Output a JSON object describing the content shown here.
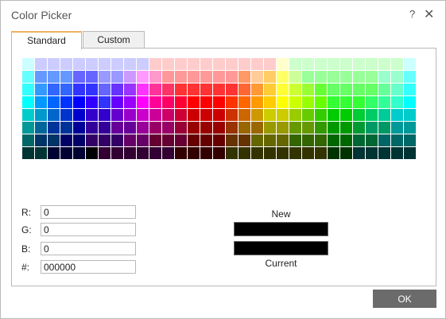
{
  "dialog": {
    "title": "Color Picker",
    "help_glyph": "?",
    "close_glyph": "✕"
  },
  "tabs": [
    {
      "label": "Standard",
      "active": true
    },
    {
      "label": "Custom",
      "active": false
    }
  ],
  "palette": {
    "columns": 31,
    "rows": 9,
    "colors": [
      [
        "#ccffff",
        "#ccccff",
        "#ccccff",
        "#ccccff",
        "#ccccff",
        "#ccccff",
        "#ccccff",
        "#ccccff",
        "#ccccff",
        "#ccccff",
        "#ffcccc",
        "#ffcccc",
        "#ffcccc",
        "#ffcccc",
        "#ffcccc",
        "#ffcccc",
        "#ffcccc",
        "#ffcccc",
        "#ffcccc",
        "#ffcccc",
        "#ffffcc",
        "#ccffcc",
        "#ccffcc",
        "#ccffcc",
        "#ccffcc",
        "#ccffcc",
        "#ccffcc",
        "#ccffcc",
        "#ccffcc",
        "#ccffcc",
        "#ccffff"
      ],
      [
        "#66ffff",
        "#6699ff",
        "#6699ff",
        "#6699ff",
        "#6666ff",
        "#6666ff",
        "#9999ff",
        "#9999ff",
        "#cc99ff",
        "#ff99ff",
        "#ff99cc",
        "#ff9999",
        "#ff9999",
        "#ff9999",
        "#ff9999",
        "#ff9999",
        "#ff9999",
        "#ff9966",
        "#ffcc99",
        "#ffcc66",
        "#ffff66",
        "#ccff99",
        "#99ff99",
        "#99ff99",
        "#99ff99",
        "#99ff99",
        "#99ff99",
        "#99ff99",
        "#99ffcc",
        "#99ffcc",
        "#66ffff"
      ],
      [
        "#33ffff",
        "#3399ff",
        "#3366ff",
        "#3366ff",
        "#3333ff",
        "#3333ff",
        "#6666ff",
        "#6633ff",
        "#9933ff",
        "#ff33ff",
        "#ff3399",
        "#ff3366",
        "#ff3333",
        "#ff3333",
        "#ff3333",
        "#ff3333",
        "#ff3333",
        "#ff6633",
        "#ff9933",
        "#ffcc33",
        "#ffff33",
        "#ccff33",
        "#99ff33",
        "#66ff33",
        "#66ff66",
        "#66ff66",
        "#66ff66",
        "#66ff66",
        "#66ff99",
        "#66ffcc",
        "#33ffff"
      ],
      [
        "#00ffff",
        "#0099ff",
        "#0066ff",
        "#0033ff",
        "#0000ff",
        "#3300ff",
        "#3333ff",
        "#6600ff",
        "#9900ff",
        "#ff00ff",
        "#ff0099",
        "#ff0066",
        "#ff0033",
        "#ff0000",
        "#ff0000",
        "#ff0000",
        "#ff3300",
        "#ff6600",
        "#ff9900",
        "#ffcc00",
        "#ffff00",
        "#ccff00",
        "#99ff00",
        "#66ff00",
        "#33ff33",
        "#33ff33",
        "#33ff33",
        "#33ff66",
        "#33ff99",
        "#33ffcc",
        "#00ffff"
      ],
      [
        "#00cccc",
        "#0099cc",
        "#0066cc",
        "#0033cc",
        "#0000cc",
        "#3300cc",
        "#3300cc",
        "#6600cc",
        "#9900cc",
        "#cc00cc",
        "#cc0099",
        "#cc0066",
        "#cc0033",
        "#cc0000",
        "#cc0000",
        "#cc0000",
        "#cc3300",
        "#cc6600",
        "#cc9900",
        "#cccc00",
        "#cccc00",
        "#99cc00",
        "#66cc00",
        "#33cc00",
        "#00cc00",
        "#00cc00",
        "#00cc33",
        "#00cc66",
        "#00cc99",
        "#00cccc",
        "#00cccc"
      ],
      [
        "#009999",
        "#006699",
        "#003399",
        "#003399",
        "#000099",
        "#330099",
        "#330099",
        "#660099",
        "#660099",
        "#990099",
        "#990066",
        "#990066",
        "#990033",
        "#990000",
        "#990000",
        "#990000",
        "#993300",
        "#996600",
        "#996600",
        "#999900",
        "#999900",
        "#669900",
        "#669900",
        "#339900",
        "#009900",
        "#009900",
        "#009933",
        "#009966",
        "#009966",
        "#009999",
        "#009999"
      ],
      [
        "#006666",
        "#003366",
        "#003366",
        "#000066",
        "#000066",
        "#330066",
        "#330066",
        "#330066",
        "#660066",
        "#660066",
        "#660033",
        "#660033",
        "#660033",
        "#660000",
        "#660000",
        "#660000",
        "#663300",
        "#663300",
        "#666600",
        "#666600",
        "#666600",
        "#336600",
        "#336600",
        "#336600",
        "#006600",
        "#006600",
        "#006633",
        "#006633",
        "#006666",
        "#006666",
        "#006666"
      ],
      [
        "#003333",
        "#003333",
        "#000033",
        "#000033",
        "#000033",
        "#000000",
        "#330033",
        "#330033",
        "#330033",
        "#330033",
        "#330033",
        "#330033",
        "#330000",
        "#330000",
        "#330000",
        "#330000",
        "#333300",
        "#333300",
        "#333300",
        "#333300",
        "#333300",
        "#333300",
        "#333300",
        "#333300",
        "#003300",
        "#003300",
        "#003333",
        "#003333",
        "#003333",
        "#003333",
        "#003333"
      ]
    ]
  },
  "rgb": {
    "r_label": "R:",
    "r_value": "0",
    "g_label": "G:",
    "g_value": "0",
    "b_label": "B:",
    "b_value": "0",
    "hex_label": "#:",
    "hex_value": "000000"
  },
  "preview": {
    "new_label": "New",
    "current_label": "Current",
    "new_color": "#000000",
    "current_color": "#000000"
  },
  "ok_label": "OK"
}
